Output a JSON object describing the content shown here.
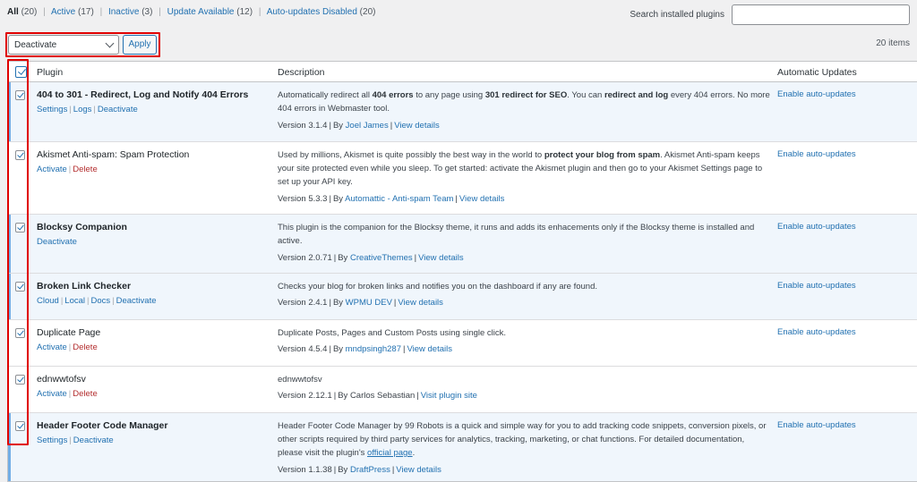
{
  "filters": {
    "all": {
      "label": "All",
      "count": "(20)"
    },
    "active": {
      "label": "Active",
      "count": "(17)"
    },
    "inactive": {
      "label": "Inactive",
      "count": "(3)"
    },
    "update": {
      "label": "Update Available",
      "count": "(12)"
    },
    "autodisabled": {
      "label": "Auto-updates Disabled",
      "count": "(20)"
    }
  },
  "search": {
    "label": "Search installed plugins",
    "value": ""
  },
  "bulk": {
    "selected": "Deactivate",
    "apply_label": "Apply",
    "items_count": "20 items"
  },
  "table": {
    "headers": {
      "plugin": "Plugin",
      "description": "Description",
      "auto_updates": "Automatic Updates"
    },
    "rows": [
      {
        "name": "404 to 301 - Redirect, Log and Notify 404 Errors",
        "actions": [
          "Settings",
          "Logs",
          "Deactivate"
        ],
        "desc_parts": [
          "Automatically redirect all ",
          "404 errors",
          " to any page using ",
          "301 redirect for SEO",
          ". You can ",
          "redirect and log",
          " every 404 errors. No more 404 errors in Webmaster tool."
        ],
        "version": "Version 3.1.4",
        "by": "By",
        "author": "Joel James",
        "details": "View details",
        "auto": "Enable auto-updates"
      },
      {
        "name": "Akismet Anti-spam: Spam Protection",
        "actions": [
          "Activate"
        ],
        "delete": "Delete",
        "desc_parts": [
          "Used by millions, Akismet is quite possibly the best way in the world to ",
          "protect your blog from spam",
          ". Akismet Anti-spam keeps your site protected even while you sleep. To get started: activate the Akismet plugin and then go to your Akismet Settings page to set up your API key."
        ],
        "version": "Version 5.3.3",
        "by": "By",
        "author": "Automattic - Anti-spam Team",
        "details": "View details",
        "auto": "Enable auto-updates"
      },
      {
        "name": "Blocksy Companion",
        "actions": [
          "Deactivate"
        ],
        "desc": "This plugin is the companion for the Blocksy theme, it runs and adds its enhacements only if the Blocksy theme is installed and active.",
        "version": "Version 2.0.71",
        "by": "By",
        "author": "CreativeThemes",
        "details": "View details",
        "auto": "Enable auto-updates"
      },
      {
        "name": "Broken Link Checker",
        "actions": [
          "Cloud",
          "Local",
          "Docs",
          "Deactivate"
        ],
        "desc": "Checks your blog for broken links and notifies you on the dashboard if any are found.",
        "version": "Version 2.4.1",
        "by": "By",
        "author": "WPMU DEV",
        "details": "View details",
        "auto": "Enable auto-updates"
      },
      {
        "name": "Duplicate Page",
        "actions": [
          "Activate"
        ],
        "delete": "Delete",
        "desc": "Duplicate Posts, Pages and Custom Posts using single click.",
        "version": "Version 4.5.4",
        "by": "By",
        "author": "mndpsingh287",
        "details": "View details",
        "auto": "Enable auto-updates"
      },
      {
        "name": "ednwwtofsv",
        "actions": [
          "Activate"
        ],
        "delete": "Delete",
        "desc": "ednwwtofsv",
        "version": "Version 2.12.1",
        "by_text": "By Carlos Sebastian",
        "details": "Visit plugin site",
        "auto": ""
      },
      {
        "name": "Header Footer Code Manager",
        "actions": [
          "Settings",
          "Deactivate"
        ],
        "desc": "Header Footer Code Manager by 99 Robots is a quick and simple way for you to add tracking code snippets, conversion pixels, or other scripts required by third party services for analytics, tracking, marketing, or chat functions. For detailed documentation, please visit the plugin's",
        "desc_link": "official page",
        "desc_end": ".",
        "version": "Version 1.1.38",
        "by": "By",
        "author": "DraftPress",
        "details": "View details",
        "auto": "Enable auto-updates"
      }
    ]
  },
  "colors": {
    "link": "#2271b1",
    "delete": "#b32d2e",
    "highlight": "#e00000",
    "active_row": "#f0f6fc"
  }
}
